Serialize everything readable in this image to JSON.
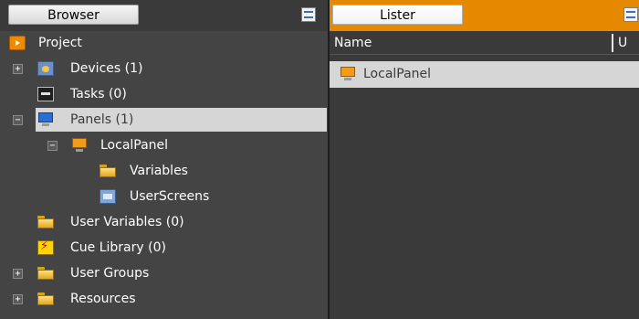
{
  "browser": {
    "tab_label": "Browser",
    "tree": [
      {
        "label": "Project",
        "icon": "project-icon",
        "expander": ""
      },
      {
        "label": "Devices (1)",
        "icon": "devices-icon",
        "expander": "+"
      },
      {
        "label": "Tasks (0)",
        "icon": "tasks-icon",
        "expander": ""
      },
      {
        "label": "Panels (1)",
        "icon": "panels-icon",
        "expander": "−",
        "selected": true
      },
      {
        "label": "LocalPanel",
        "icon": "local-panel-icon",
        "expander": "−"
      },
      {
        "label": "Variables",
        "icon": "folder-icon",
        "expander": ""
      },
      {
        "label": "UserScreens",
        "icon": "user-screens-icon",
        "expander": ""
      },
      {
        "label": "User Variables (0)",
        "icon": "folder-icon",
        "expander": ""
      },
      {
        "label": "Cue Library (0)",
        "icon": "cue-library-icon",
        "expander": ""
      },
      {
        "label": "User Groups",
        "icon": "folder-icon",
        "expander": "+"
      },
      {
        "label": "Resources",
        "icon": "folder-icon",
        "expander": "+"
      }
    ]
  },
  "lister": {
    "tab_label": "Lister",
    "columns": {
      "name": "Name",
      "u": "U"
    },
    "rows": [
      {
        "label": "LocalPanel",
        "icon": "local-panel-icon"
      }
    ]
  },
  "colors": {
    "accent": "#e48900",
    "background": "#444444",
    "selection": "#d6d6d6"
  }
}
